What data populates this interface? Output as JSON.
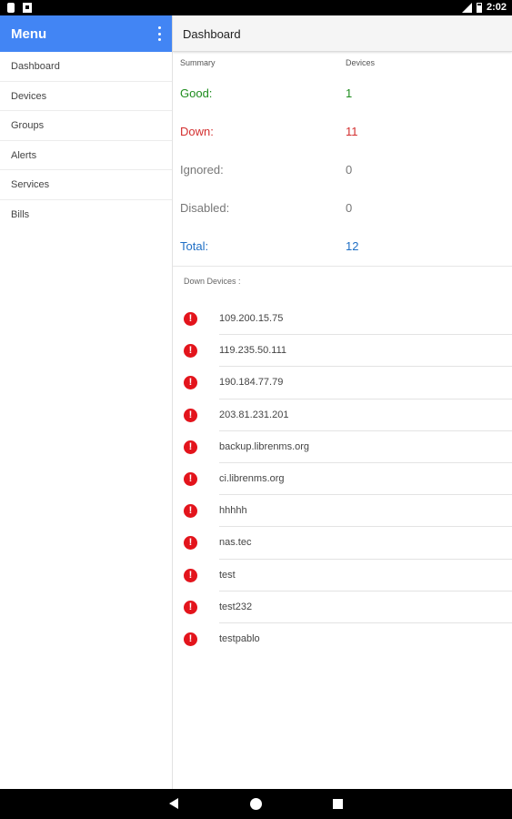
{
  "status_bar": {
    "time": "2:02",
    "left_icons": [
      "phone-icon",
      "image-icon"
    ],
    "right_icons": [
      "signal-icon",
      "battery-icon"
    ]
  },
  "drawer": {
    "title": "Menu",
    "items": [
      {
        "label": "Dashboard"
      },
      {
        "label": "Devices"
      },
      {
        "label": "Groups"
      },
      {
        "label": "Alerts"
      },
      {
        "label": "Services"
      },
      {
        "label": "Bills"
      }
    ]
  },
  "toolbar": {
    "title": "Dashboard"
  },
  "summary": {
    "col_summary": "Summary",
    "col_devices": "Devices",
    "rows": [
      {
        "label": "Good:",
        "value": "1",
        "color": "#1e8c1e"
      },
      {
        "label": "Down:",
        "value": "11",
        "color": "#d32f2f"
      },
      {
        "label": "Ignored:",
        "value": "0",
        "color": "#777777"
      },
      {
        "label": "Disabled:",
        "value": "0",
        "color": "#777777"
      },
      {
        "label": "Total:",
        "value": "12",
        "color": "#1f6fc5"
      }
    ]
  },
  "down_devices": {
    "title": "Down Devices :",
    "icon": "error-icon",
    "icon_color": "#e3141c",
    "items": [
      {
        "name": "109.200.15.75"
      },
      {
        "name": "119.235.50.111"
      },
      {
        "name": "190.184.77.79"
      },
      {
        "name": "203.81.231.201"
      },
      {
        "name": "backup.librenms.org"
      },
      {
        "name": "ci.librenms.org"
      },
      {
        "name": "hhhhh"
      },
      {
        "name": "nas.tec"
      },
      {
        "name": "test"
      },
      {
        "name": "test232"
      },
      {
        "name": "testpablo"
      }
    ]
  },
  "nav_bar": {
    "buttons": [
      "back-icon",
      "home-icon",
      "recents-icon"
    ]
  }
}
